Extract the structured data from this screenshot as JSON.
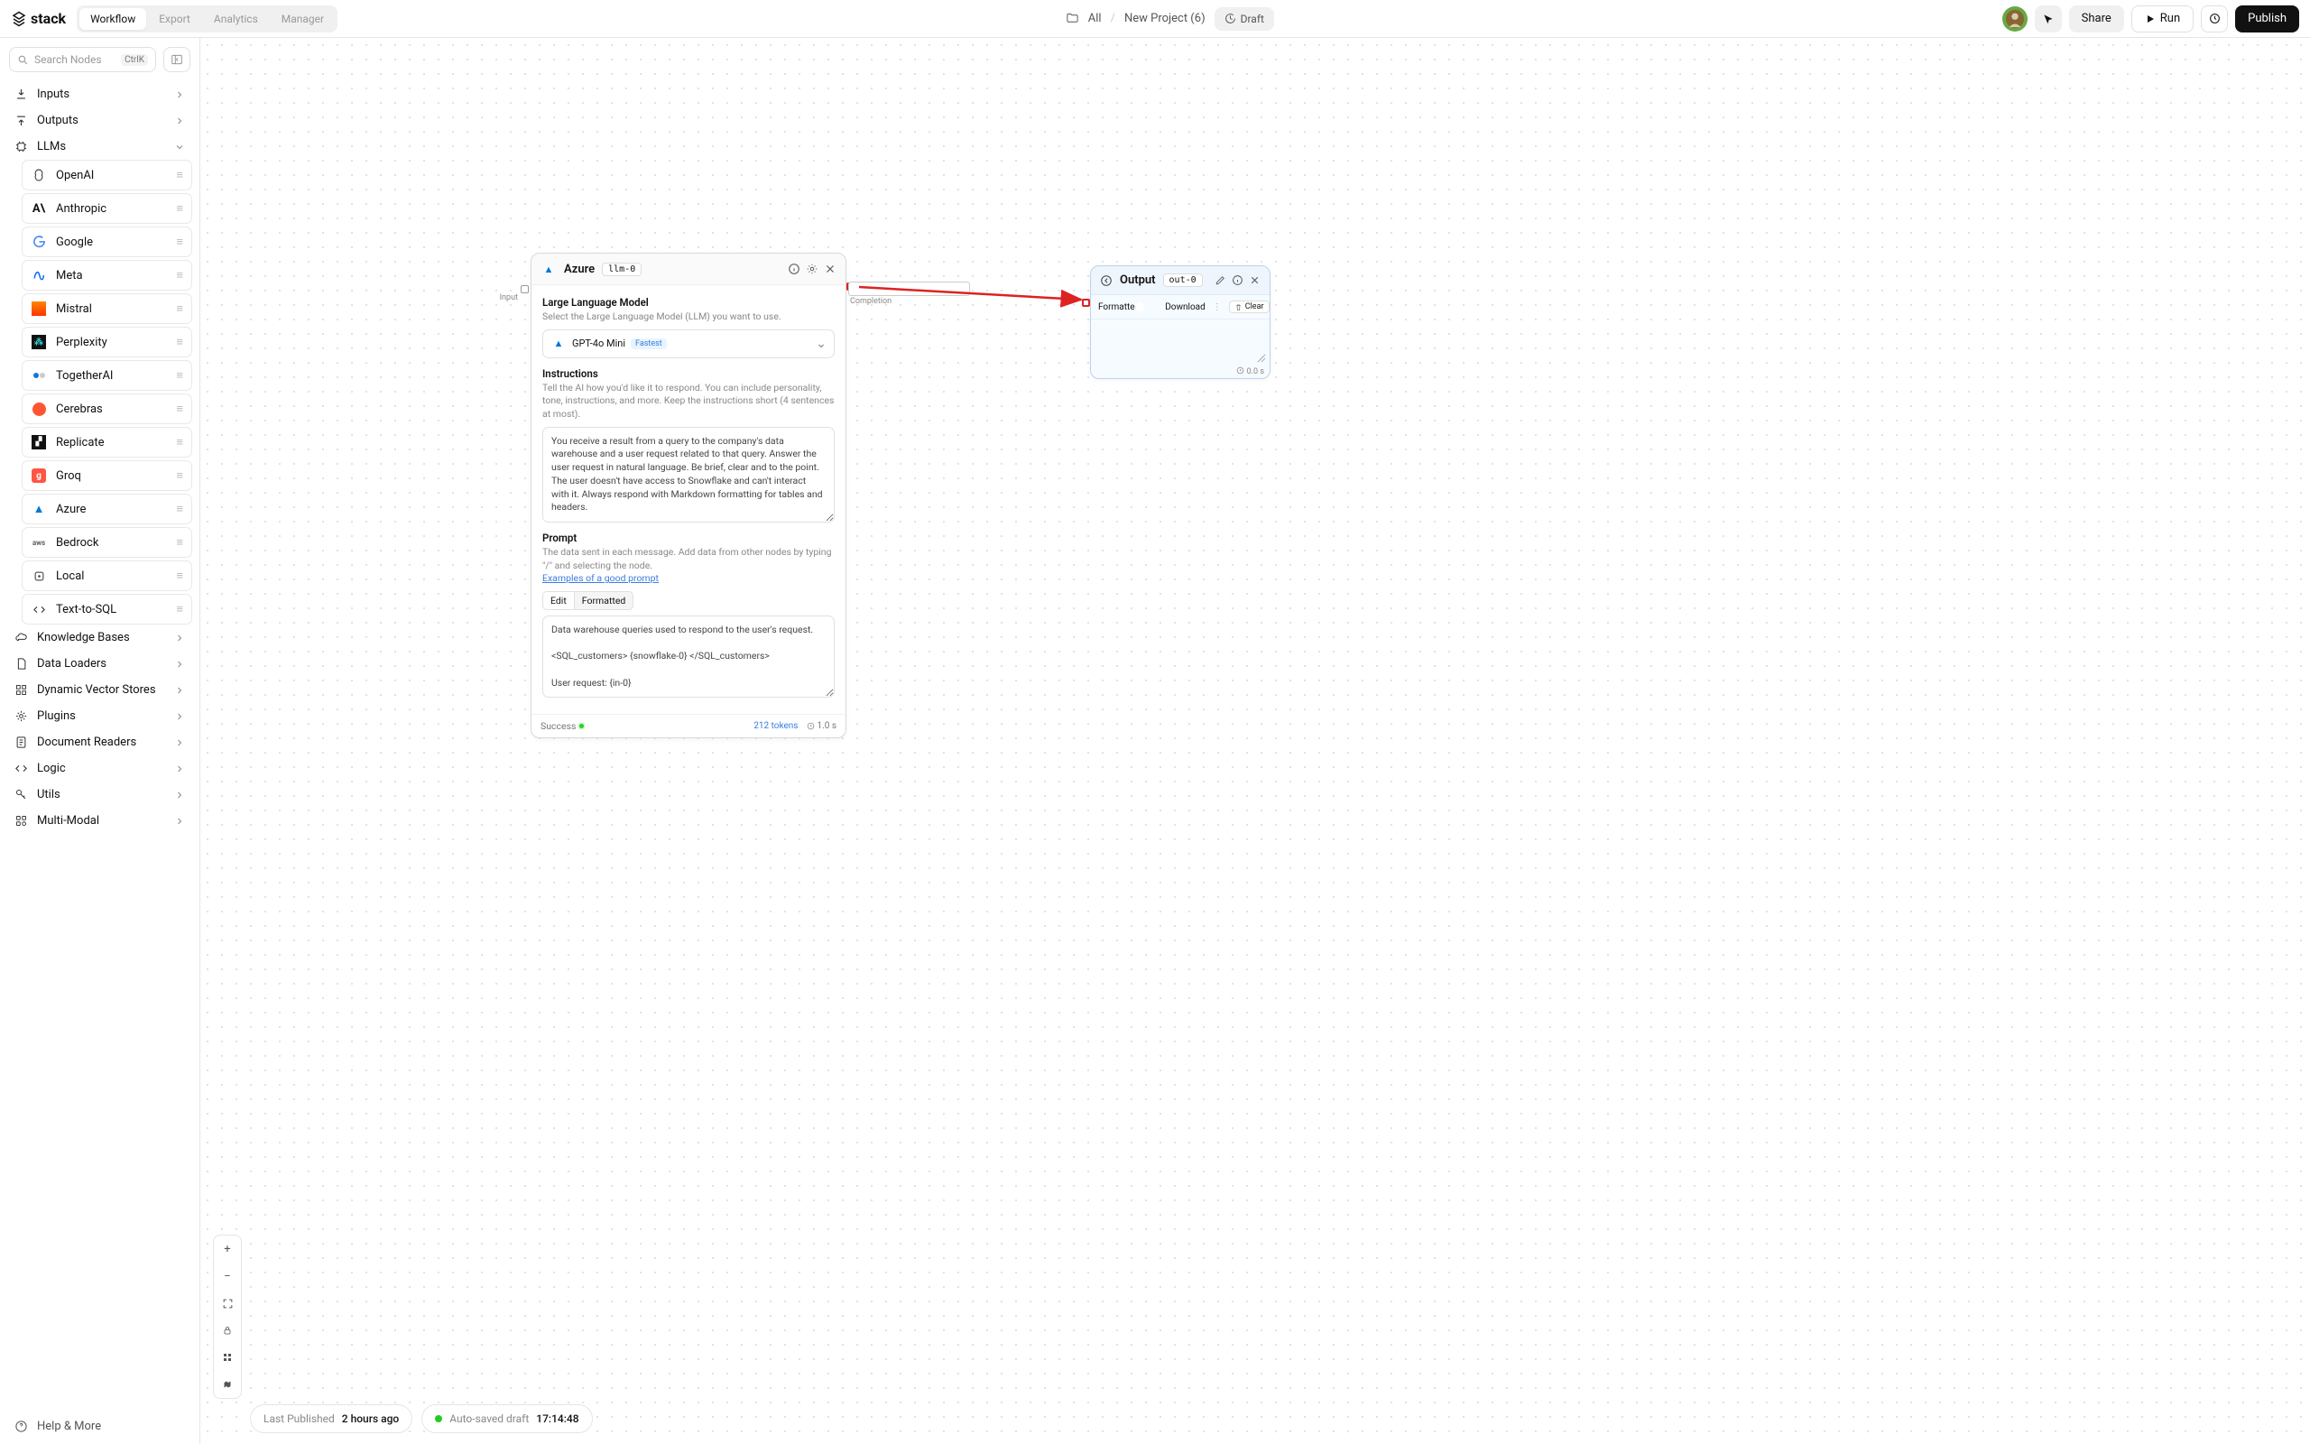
{
  "app": {
    "name": "stack"
  },
  "tabs": {
    "workflow": "Workflow",
    "export": "Export",
    "analytics": "Analytics",
    "manager": "Manager"
  },
  "breadcrumb": {
    "all": "All",
    "project": "New Project (6)",
    "draft": "Draft"
  },
  "actions": {
    "share": "Share",
    "run": "Run",
    "publish": "Publish"
  },
  "search": {
    "placeholder": "Search Nodes",
    "kbd": "CtrlK"
  },
  "sidebar": {
    "inputs": "Inputs",
    "outputs": "Outputs",
    "llms": "LLMs",
    "knowledge": "Knowledge Bases",
    "loaders": "Data Loaders",
    "vector": "Dynamic Vector Stores",
    "plugins": "Plugins",
    "readers": "Document Readers",
    "logic": "Logic",
    "utils": "Utils",
    "multimodal": "Multi-Modal",
    "help": "Help & More"
  },
  "providers": [
    "OpenAI",
    "Anthropic",
    "Google",
    "Meta",
    "Mistral",
    "Perplexity",
    "TogetherAI",
    "Cerebras",
    "Replicate",
    "Groq",
    "Azure",
    "Bedrock",
    "Local",
    "Text-to-SQL"
  ],
  "azure_node": {
    "title": "Azure",
    "tag": "llm-0",
    "s1_title": "Large Language Model",
    "s1_sub": "Select the Large Language Model (LLM) you want to use.",
    "model": "GPT-4o Mini",
    "fast": "Fastest",
    "s2_title": "Instructions",
    "s2_sub": "Tell the AI how you'd like it to respond. You can include personality, tone, instructions, and more. Keep the instructions short (4 sentences at most).",
    "instructions_text": "You receive a result from a query to the company's data warehouse and a user request related to that query. Answer the user request in natural language. Be brief, clear and to the point. The user doesn't have access to Snowflake and can't interact with it. Always respond with Markdown formatting for tables and headers.",
    "s3_title": "Prompt",
    "s3_sub": "The data sent in each message. Add data from other nodes by typing \"/\" and selecting the node.",
    "examples": "Examples of a good prompt",
    "tab_edit": "Edit",
    "tab_formatted": "Formatted",
    "prompt_text": "Data warehouse queries used to respond to the user's request.\n\n<SQL_customers> {snowflake-0} </SQL_customers>\n\nUser request: {in-0}",
    "status": "Success",
    "tokens": "212 tokens",
    "time": "1.0 s"
  },
  "input_node": {
    "label": "Input"
  },
  "edge": {
    "label": "Completion"
  },
  "output_node": {
    "title": "Output",
    "tag": "out-0",
    "formatted": "Formatted",
    "download": "Download",
    "clear": "Clear",
    "time": "0.0 s"
  },
  "status": {
    "last_pub_label": "Last Published",
    "last_pub_val": "2 hours ago",
    "autosave": "Auto-saved draft",
    "autosave_time": "17:14:48"
  }
}
